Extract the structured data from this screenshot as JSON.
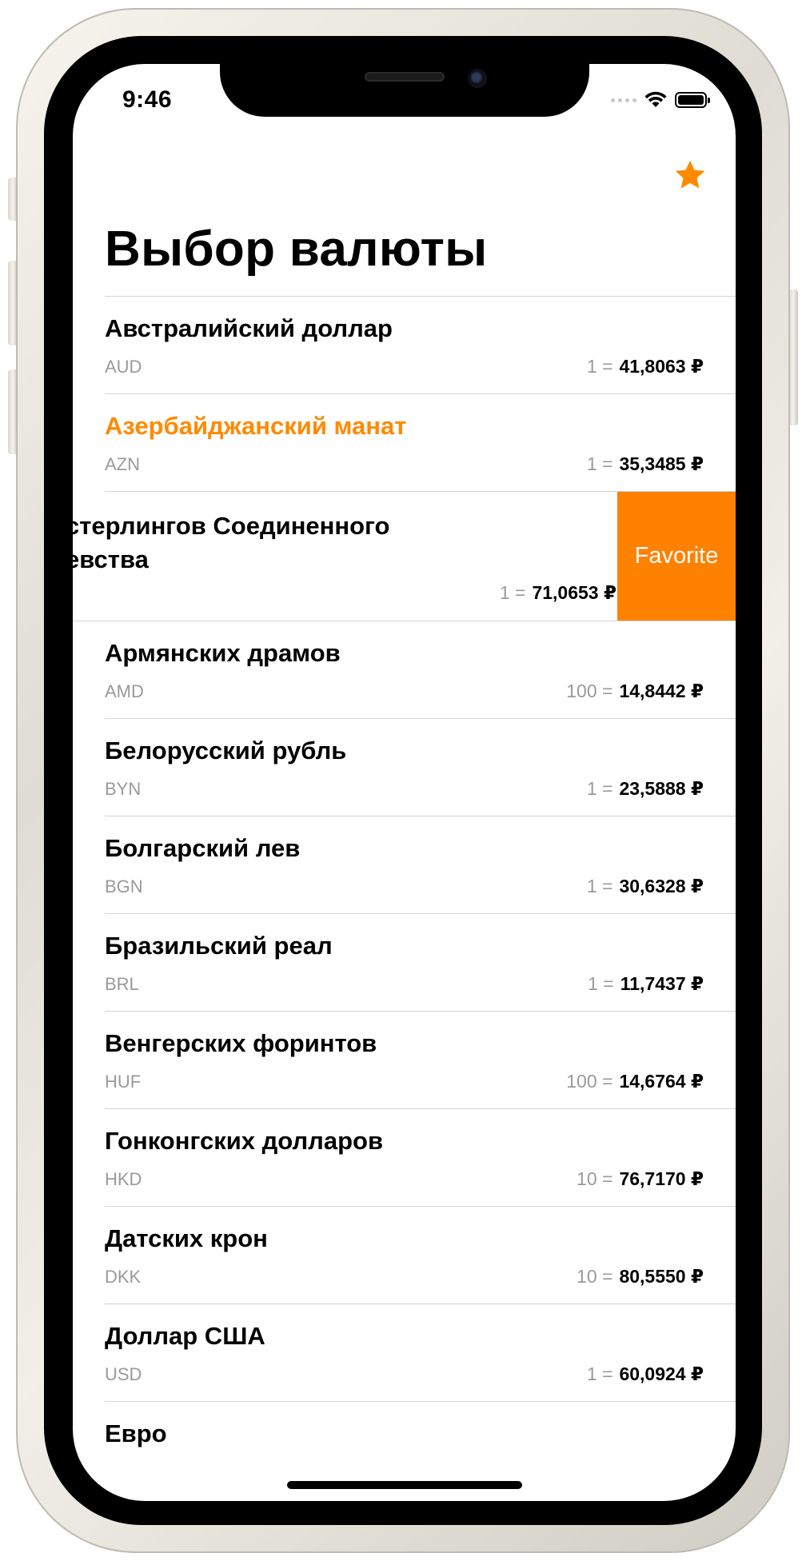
{
  "status_bar": {
    "time": "9:46"
  },
  "nav": {
    "favorite_icon": "star-icon",
    "title": "Выбор валюты"
  },
  "accent_color": "#ff8a00",
  "currencies": [
    {
      "name": "Австралийский доллар",
      "code": "AUD",
      "units": "1 =",
      "rate": "41,8063 ₽",
      "favorite": false
    },
    {
      "name": "Азербайджанский манат",
      "code": "AZN",
      "units": "1 =",
      "rate": "35,3485 ₽",
      "favorite": true
    },
    {
      "name_line1": "стерлингов Соединенного",
      "name_line2": "евства",
      "units": "1 =",
      "rate": "71,0653 ₽",
      "swipe_action": "Favorite"
    },
    {
      "name": "Армянских драмов",
      "code": "AMD",
      "units": "100 =",
      "rate": "14,8442 ₽"
    },
    {
      "name": "Белорусский рубль",
      "code": "BYN",
      "units": "1 =",
      "rate": "23,5888 ₽"
    },
    {
      "name": "Болгарский лев",
      "code": "BGN",
      "units": "1 =",
      "rate": "30,6328 ₽"
    },
    {
      "name": "Бразильский реал",
      "code": "BRL",
      "units": "1 =",
      "rate": "11,7437 ₽"
    },
    {
      "name": "Венгерских форинтов",
      "code": "HUF",
      "units": "100 =",
      "rate": "14,6764 ₽"
    },
    {
      "name": "Гонконгских долларов",
      "code": "HKD",
      "units": "10 =",
      "rate": "76,7170 ₽"
    },
    {
      "name": "Датских крон",
      "code": "DKK",
      "units": "10 =",
      "rate": "80,5550 ₽"
    },
    {
      "name": "Доллар США",
      "code": "USD",
      "units": "1 =",
      "rate": "60,0924 ₽"
    },
    {
      "name": "Евро"
    }
  ]
}
